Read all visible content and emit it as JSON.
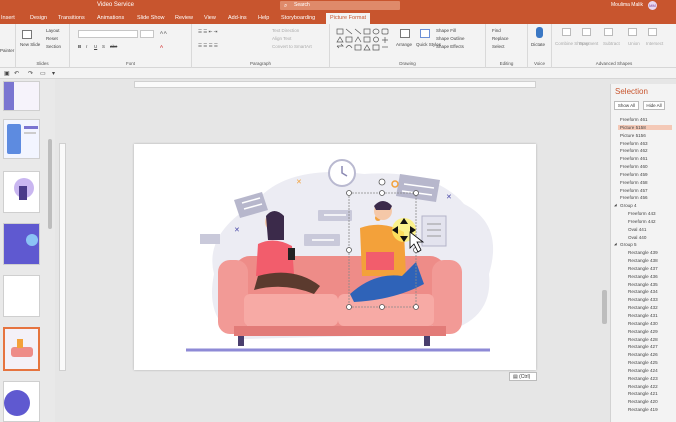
{
  "title_bar": {
    "doc": "Video Service",
    "search": "Search",
    "user": "Moulima Malik",
    "avatar": "MM"
  },
  "tabs": [
    "Insert",
    "Design",
    "Transitions",
    "Animations",
    "Slide Show",
    "Review",
    "View",
    "Add-ins",
    "Help",
    "Storyboarding",
    "Picture Format"
  ],
  "active_tab": "Picture Format",
  "ribbon": {
    "slides": {
      "new_slide": "New Slide",
      "layout": "Layout",
      "reset": "Reset",
      "section": "Section",
      "label": "Slides"
    },
    "font": {
      "label": "Font"
    },
    "paragraph": {
      "text_direction": "Text Direction",
      "align_text": "Align Text",
      "convert": "Convert to SmartArt",
      "label": "Paragraph"
    },
    "drawing": {
      "arrange": "Arrange",
      "quick_styles": "Quick Styles",
      "shape_fill": "Shape Fill",
      "shape_outline": "Shape Outline",
      "shape_effects": "Shape Effects",
      "label": "Drawing"
    },
    "editing": {
      "find": "Find",
      "replace": "Replace",
      "select": "Select",
      "label": "Editing"
    },
    "voice": {
      "dictate": "Dictate",
      "label": "Voice"
    },
    "advanced": {
      "items": [
        "Combine Shapes",
        "Fragment",
        "Subtract",
        "Union",
        "Intersect"
      ],
      "label": "Advanced Shapes"
    },
    "printer": "Painter"
  },
  "paste_options": "(Ctrl)",
  "selection_pane": {
    "title": "Selection",
    "show_all": "Show All",
    "hide_all": "Hide All",
    "items": [
      {
        "label": "Freeform 461",
        "indent": 0
      },
      {
        "label": "Picture 5158",
        "indent": 0,
        "selected": true
      },
      {
        "label": "Picture 5156",
        "indent": 0
      },
      {
        "label": "Freeform 463",
        "indent": 0
      },
      {
        "label": "Freeform 462",
        "indent": 0
      },
      {
        "label": "Freeform 461",
        "indent": 0
      },
      {
        "label": "Freeform 460",
        "indent": 0
      },
      {
        "label": "Freeform 459",
        "indent": 0
      },
      {
        "label": "Freeform 458",
        "indent": 0
      },
      {
        "label": "Freeform 457",
        "indent": 0
      },
      {
        "label": "Freeform 456",
        "indent": 0
      },
      {
        "label": "Group 4",
        "indent": 0,
        "group": true
      },
      {
        "label": "Freeform 443",
        "indent": 1
      },
      {
        "label": "Freeform 442",
        "indent": 1
      },
      {
        "label": "Oval 441",
        "indent": 1
      },
      {
        "label": "Oval 440",
        "indent": 1
      },
      {
        "label": "Group 5",
        "indent": 0,
        "group": true
      },
      {
        "label": "Rectangle 439",
        "indent": 1
      },
      {
        "label": "Rectangle 438",
        "indent": 1
      },
      {
        "label": "Rectangle 437",
        "indent": 1
      },
      {
        "label": "Rectangle 436",
        "indent": 1
      },
      {
        "label": "Rectangle 435",
        "indent": 1
      },
      {
        "label": "Rectangle 434",
        "indent": 1
      },
      {
        "label": "Rectangle 433",
        "indent": 1
      },
      {
        "label": "Rectangle 432",
        "indent": 1
      },
      {
        "label": "Rectangle 431",
        "indent": 1
      },
      {
        "label": "Rectangle 430",
        "indent": 1
      },
      {
        "label": "Rectangle 429",
        "indent": 1
      },
      {
        "label": "Rectangle 428",
        "indent": 1
      },
      {
        "label": "Rectangle 427",
        "indent": 1
      },
      {
        "label": "Rectangle 426",
        "indent": 1
      },
      {
        "label": "Rectangle 425",
        "indent": 1
      },
      {
        "label": "Rectangle 424",
        "indent": 1
      },
      {
        "label": "Rectangle 423",
        "indent": 1
      },
      {
        "label": "Rectangle 422",
        "indent": 1
      },
      {
        "label": "Rectangle 421",
        "indent": 1
      },
      {
        "label": "Rectangle 420",
        "indent": 1
      },
      {
        "label": "Rectangle 419",
        "indent": 1
      }
    ]
  },
  "colors": {
    "accent": "#c8552e",
    "selected_row": "#f4c9b7",
    "sofa": "#ee8c88",
    "purple": "#7a75d1"
  }
}
